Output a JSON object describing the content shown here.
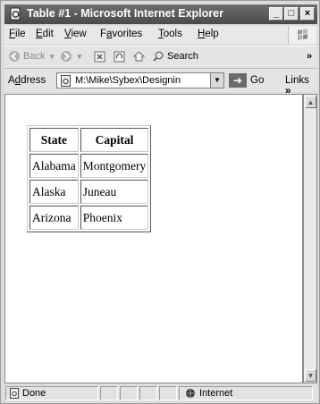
{
  "window": {
    "title": "Table #1 - Microsoft Internet Explorer",
    "controls": {
      "minimize": "_",
      "maximize": "□",
      "close": "×"
    }
  },
  "menu": {
    "items": [
      {
        "label": "File",
        "accel": "F",
        "rest": "ile"
      },
      {
        "label": "Edit",
        "accel": "E",
        "rest": "dit"
      },
      {
        "label": "View",
        "accel": "V",
        "rest": "iew"
      },
      {
        "label": "Favorites",
        "pre": "F",
        "accel": "a",
        "rest": "vorites"
      },
      {
        "label": "Tools",
        "accel": "T",
        "rest": "ools"
      },
      {
        "label": "Help",
        "accel": "H",
        "rest": "elp"
      }
    ]
  },
  "toolbar": {
    "back": "Back",
    "search": "Search",
    "more": "»"
  },
  "address": {
    "label_pre": "A",
    "label_accel": "d",
    "label_rest": "dress",
    "url": "M:\\Mike\\Sybex\\Designin",
    "go": "Go",
    "links": "Links",
    "links_more": "»"
  },
  "table": {
    "headers": [
      "State",
      "Capital"
    ],
    "rows": [
      [
        "Alabama",
        "Montgomery"
      ],
      [
        "Alaska",
        "Juneau"
      ],
      [
        "Arizona",
        "Phoenix"
      ]
    ]
  },
  "status": {
    "text": "Done",
    "zone": "Internet"
  }
}
